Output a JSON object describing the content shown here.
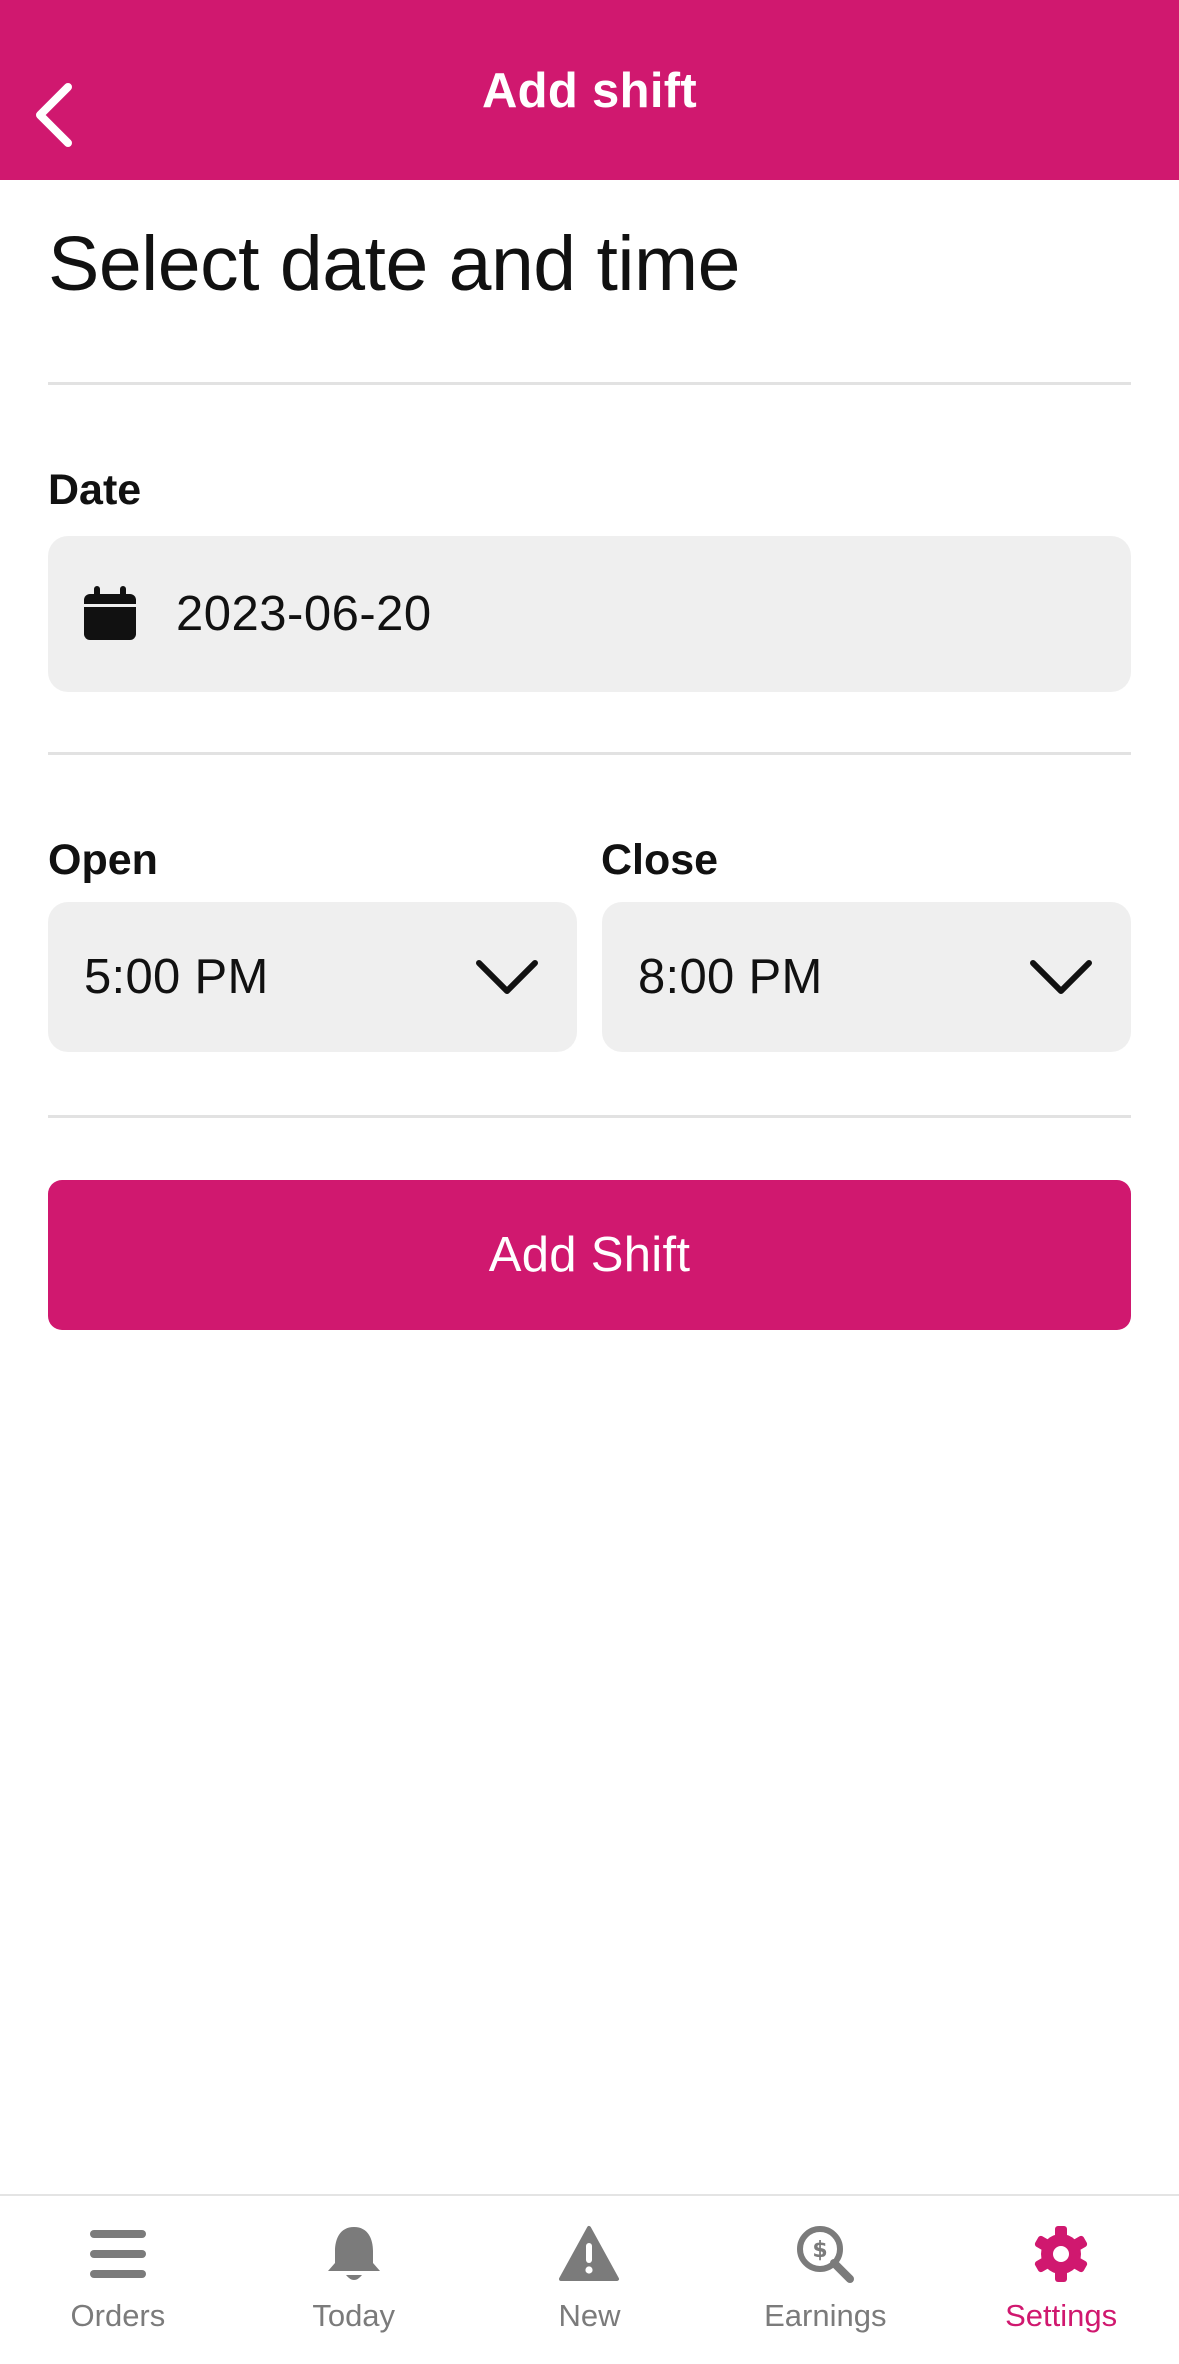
{
  "colors": {
    "brand": "#d0186f",
    "field_bg": "#efefef",
    "tab_inactive": "#7b7b7b"
  },
  "header": {
    "title": "Add shift",
    "back_icon": "chevron-left-icon"
  },
  "page": {
    "title": "Select date and time"
  },
  "date": {
    "label": "Date",
    "value": "2023-06-20",
    "icon": "calendar-icon"
  },
  "open": {
    "label": "Open",
    "value": "5:00 PM"
  },
  "close": {
    "label": "Close",
    "value": "8:00 PM"
  },
  "submit": {
    "label": "Add Shift"
  },
  "tabs": [
    {
      "label": "Orders",
      "icon": "menu-icon",
      "active": false
    },
    {
      "label": "Today",
      "icon": "bell-icon",
      "active": false
    },
    {
      "label": "New",
      "icon": "warning-icon",
      "active": false
    },
    {
      "label": "Earnings",
      "icon": "dollar-search-icon",
      "active": false
    },
    {
      "label": "Settings",
      "icon": "gear-icon",
      "active": true
    }
  ]
}
